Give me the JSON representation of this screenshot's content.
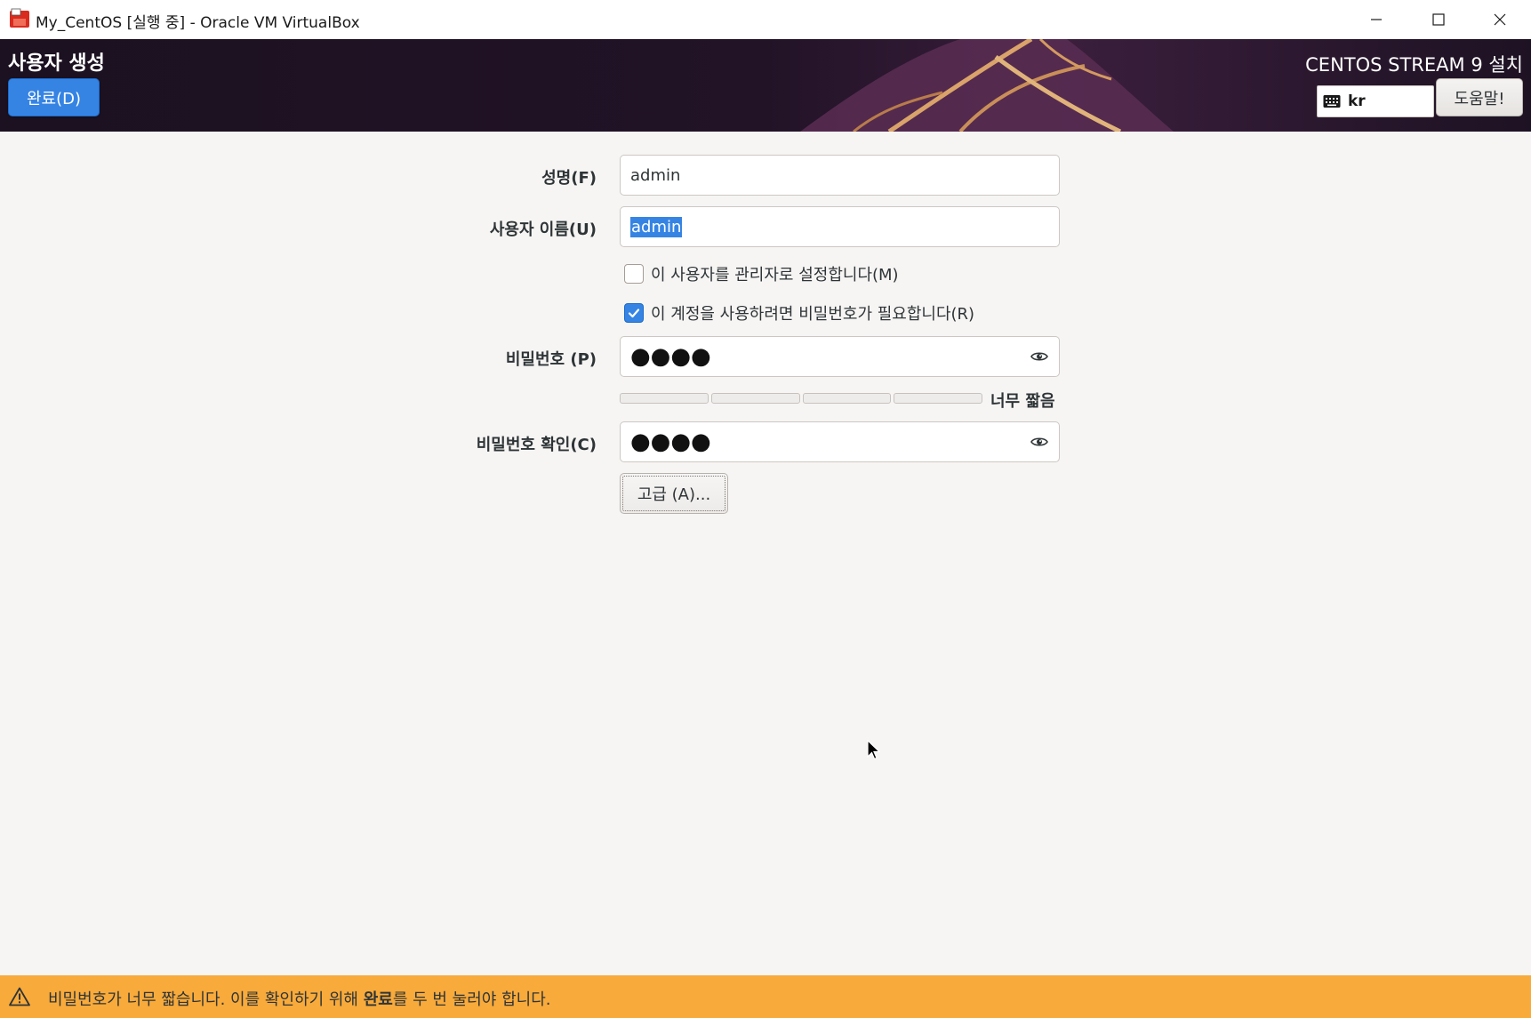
{
  "window": {
    "title": "My_CentOS [실행 중] - Oracle VM VirtualBox"
  },
  "header": {
    "spoke_title": "사용자 생성",
    "done_button": "완료(D)",
    "product_title": "CENTOS STREAM 9 설치",
    "keyboard_layout": "kr",
    "help_button": "도움말!"
  },
  "form": {
    "full_name": {
      "label": "성명(F)",
      "value": "admin"
    },
    "user_name": {
      "label": "사용자 이름(U)",
      "value": "admin"
    },
    "admin_checkbox": {
      "label": "이 사용자를 관리자로 설정합니다(M)",
      "checked": false
    },
    "require_password_checkbox": {
      "label": "이 계정을 사용하려면 비밀번호가 필요합니다(R)",
      "checked": true
    },
    "password": {
      "label": "비밀번호 (P)",
      "masked": "●●●●"
    },
    "strength": {
      "label": "너무 짧음",
      "filled_segments": 0,
      "total_segments": 4
    },
    "confirm_password": {
      "label": "비밀번호 확인(C)",
      "masked": "●●●●"
    },
    "advanced_button": "고급 (A)..."
  },
  "warning": {
    "text_before": "비밀번호가 너무 짧습니다. 이를 확인하기 위해 ",
    "text_bold": "완료",
    "text_after": "를 두 번 눌러야 합니다."
  },
  "colors": {
    "accent": "#3584e4",
    "warning_bg": "#f8aa3b",
    "header_bg": "#1a1120",
    "page_bg": "#f6f5f4"
  },
  "icons": [
    "virtualbox-app-icon",
    "minimize-icon",
    "maximize-icon",
    "close-icon",
    "keyboard-icon",
    "eye-icon",
    "checkmark-icon",
    "warning-icon",
    "mouse-cursor-icon"
  ]
}
